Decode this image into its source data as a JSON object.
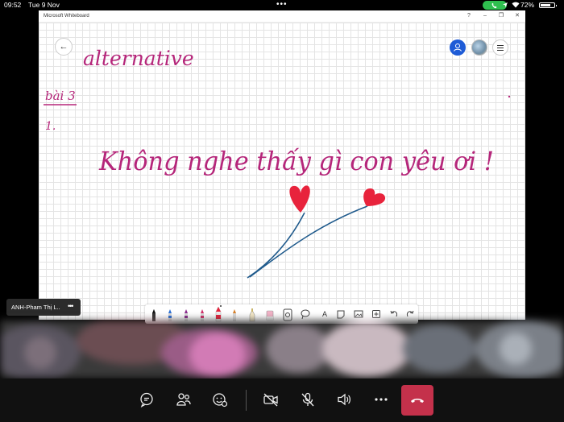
{
  "status_bar": {
    "time": "09:52",
    "date": "Tue 9 Nov",
    "battery_percent": "72%",
    "battery_level": 0.72,
    "icons": [
      "dots-icon",
      "call-pill-icon",
      "location-icon",
      "wifi-icon",
      "battery-icon"
    ]
  },
  "window": {
    "title": "Microsoft Whiteboard",
    "controls": [
      "?",
      "–",
      "❐",
      "✕"
    ]
  },
  "canvas": {
    "heading": "alternative",
    "section": "bài 3",
    "item_number": "1.",
    "message": "Không nghe thấy gì con yêu ơi !",
    "ink_color": "#b5267a",
    "drawing_stem_color": "#1f5a8c",
    "drawing_heart_color": "#e8233c"
  },
  "toolbar": {
    "tools": [
      "pen-black-icon",
      "pen-blue-icon",
      "pen-purple-icon",
      "pen-red-icon",
      "pen-red-selected-icon",
      "pen-orange-icon",
      "highlighter-icon",
      "eraser-icon",
      "ruler-icon",
      "lasso-icon",
      "text-icon",
      "sticky-note-icon",
      "image-icon",
      "add-icon",
      "undo-icon",
      "redo-icon"
    ],
    "text_tool_label": "A"
  },
  "participant": {
    "name": "ANH-Pham Thị L..",
    "more": "•••"
  },
  "call_bar": {
    "buttons": [
      "chat-icon",
      "participants-icon",
      "reactions-icon",
      "camera-off-icon",
      "mic-off-icon",
      "speaker-icon",
      "more-icon",
      "hang-up-icon"
    ],
    "hangup_color": "#c4314b"
  }
}
